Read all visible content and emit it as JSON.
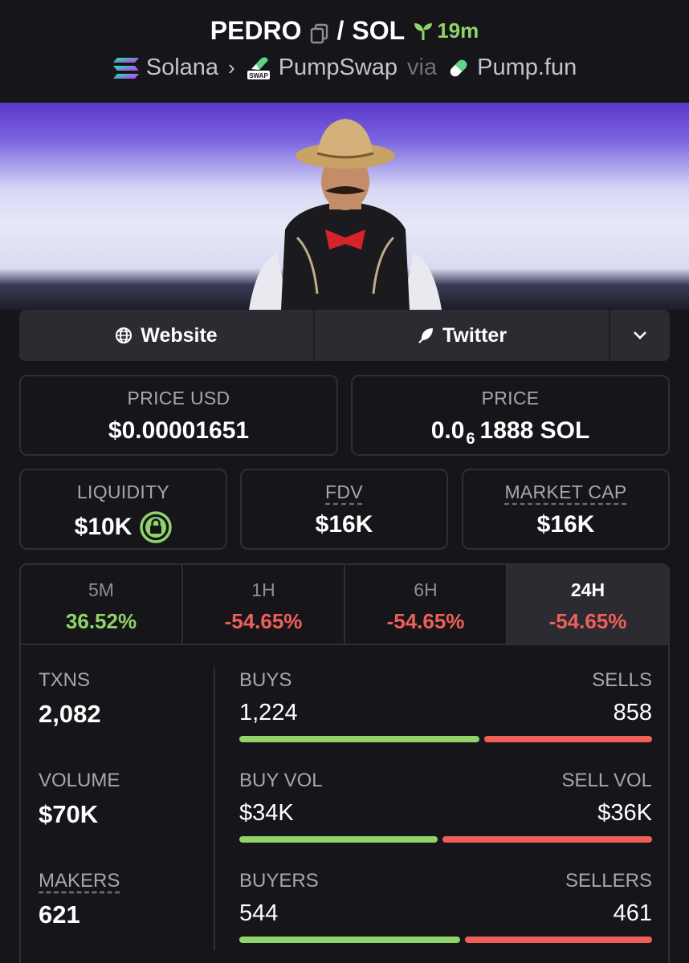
{
  "header": {
    "token": "PEDRO",
    "pair_sep": "/",
    "quote": "SOL",
    "age": "19m",
    "chain": "Solana",
    "dex": "PumpSwap",
    "via": "via",
    "launchpad": "Pump.fun"
  },
  "links": {
    "website": "Website",
    "twitter": "Twitter"
  },
  "price_usd": {
    "label": "PRICE USD",
    "value": "$0.00001651"
  },
  "price": {
    "label": "PRICE",
    "prefix": "0.0",
    "sub": "6",
    "suffix": "1888 SOL"
  },
  "liquidity": {
    "label": "LIQUIDITY",
    "value": "$10K"
  },
  "fdv": {
    "label": "FDV",
    "value": "$16K"
  },
  "market_cap": {
    "label": "MARKET CAP",
    "value": "$16K"
  },
  "tabs": [
    {
      "label": "5M",
      "value": "36.52%"
    },
    {
      "label": "1H",
      "value": "-54.65%"
    },
    {
      "label": "6H",
      "value": "-54.65%"
    },
    {
      "label": "24H",
      "value": "-54.65%"
    }
  ],
  "stats": {
    "txns": {
      "label": "TXNS",
      "value": "2,082"
    },
    "volume": {
      "label": "VOLUME",
      "value": "$70K"
    },
    "makers": {
      "label": "MAKERS",
      "value": "621"
    },
    "buys": {
      "label": "BUYS",
      "value": "1,224",
      "sell_label": "SELLS",
      "sell_value": "858",
      "buy_share": 0.588
    },
    "vol": {
      "label": "BUY VOL",
      "value": "$34K",
      "sell_label": "SELL VOL",
      "sell_value": "$36K",
      "buy_share": 0.486
    },
    "buyers": {
      "label": "BUYERS",
      "value": "544",
      "sell_label": "SELLERS",
      "sell_value": "461",
      "buy_share": 0.541
    }
  },
  "colors": {
    "positive": "#8fd36a",
    "negative": "#ef5f5a",
    "background": "#16161a"
  }
}
